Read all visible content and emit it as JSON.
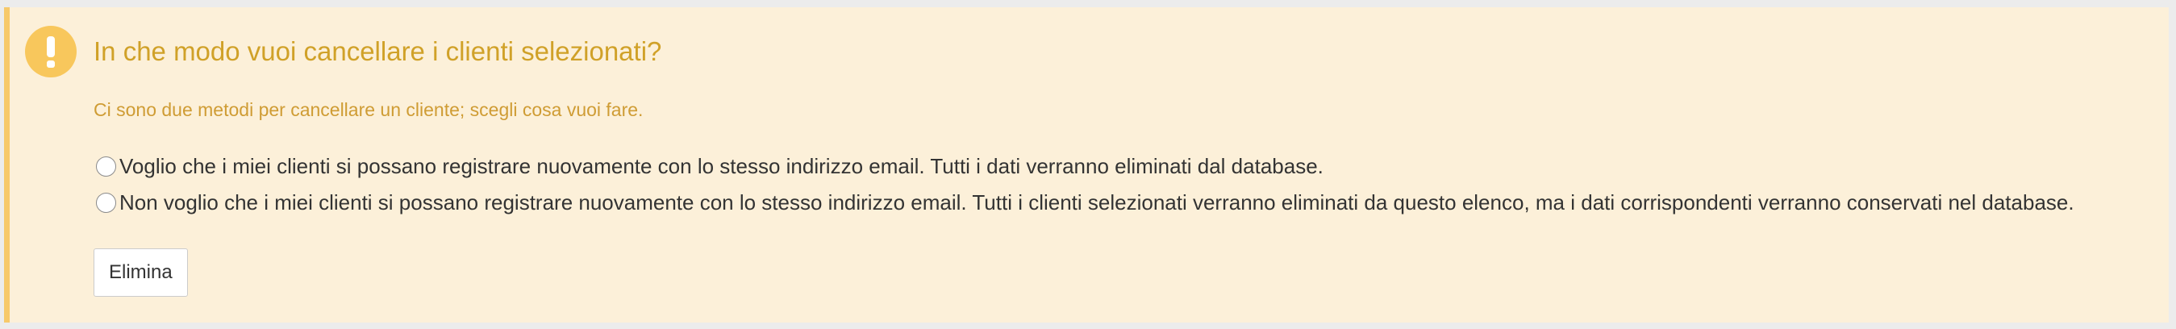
{
  "alert": {
    "icon": "exclamation-icon",
    "title": "In che modo vuoi cancellare i clienti selezionati?",
    "description": "Ci sono due metodi per cancellare un cliente; scegli cosa vuoi fare.",
    "options": [
      {
        "label": "Voglio che i miei clienti si possano registrare nuovamente con lo stesso indirizzo email. Tutti i dati verranno eliminati dal database.",
        "selected": false
      },
      {
        "label": "Non voglio che i miei clienti si possano registrare nuovamente con lo stesso indirizzo email. Tutti i clienti selezionati verranno eliminati da questo elenco, ma i dati corrispondenti verranno conservati nel database.",
        "selected": false
      }
    ],
    "button_label": "Elimina"
  },
  "colors": {
    "background": "#ececec",
    "alert_background": "#fcf0d9",
    "alert_border": "#f7c96a",
    "icon_circle": "#f8c75c",
    "title_text": "#d0a128",
    "description_text": "#cf9c34",
    "body_text": "#333333"
  }
}
